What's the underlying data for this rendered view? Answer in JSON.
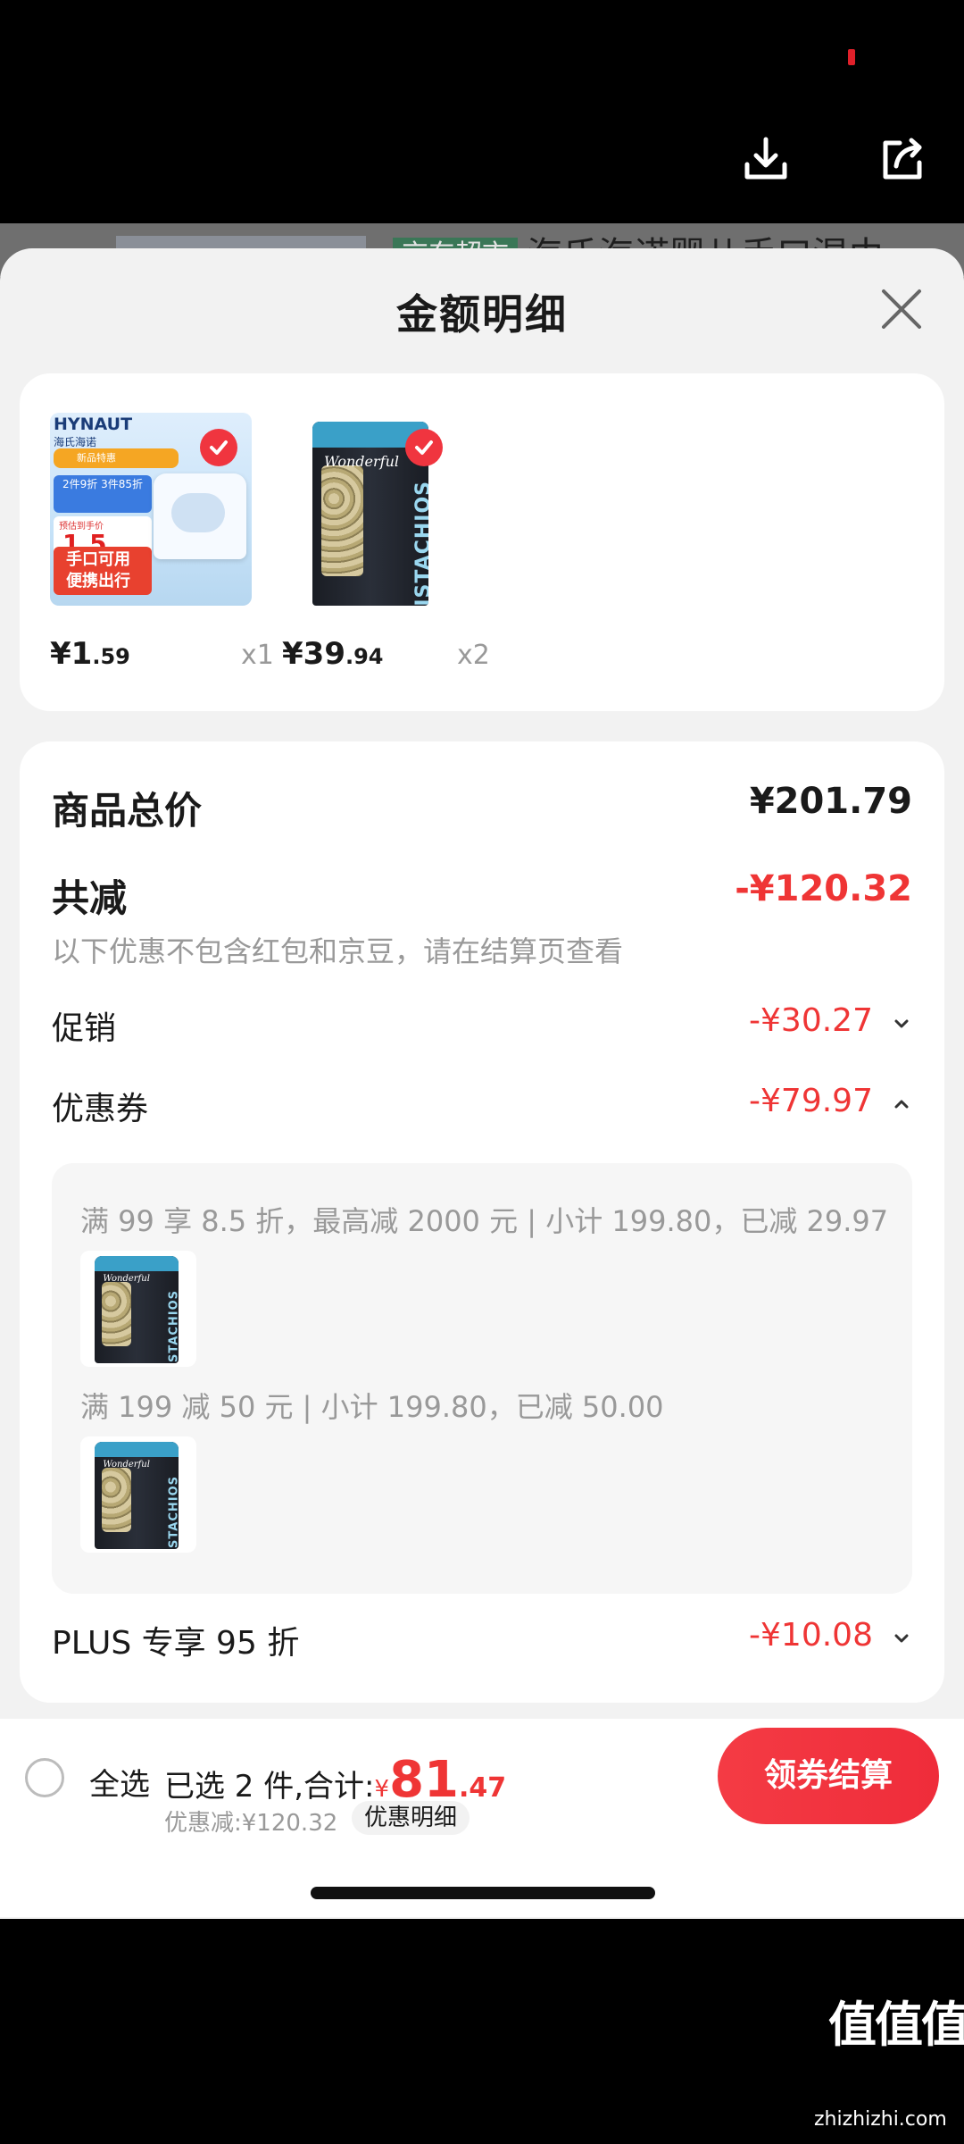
{
  "header": {
    "download_icon": "download-icon",
    "share_icon": "share-icon"
  },
  "background_page": {
    "tag": "京东超市",
    "title": "海氏海诺婴儿手口湿巾"
  },
  "sheet": {
    "title": "金额明细",
    "close_icon": "close-icon"
  },
  "products": [
    {
      "image": {
        "brand": "HYNAUT",
        "brand_sub": "海氏海诺",
        "promo_top": "新品特惠",
        "promo_deal": "2件9折 3件85折",
        "price_label": "预估到手价",
        "price_badge": "1.5",
        "slogan": "手口可用 便携出行"
      },
      "price_int": "¥1",
      "price_dec": ".59",
      "qty": "x1",
      "selected": true
    },
    {
      "image": {
        "brand": "Wonderful",
        "product": "PISTACHIOS"
      },
      "price_int": "¥39",
      "price_dec": ".94",
      "qty": "x2",
      "selected": true
    }
  ],
  "summary": {
    "total_label": "商品总价",
    "total_value": "¥201.79",
    "minus_label": "共减",
    "minus_value": "-¥120.32",
    "note": "以下优惠不包含红包和京豆，请在结算页查看",
    "promo_label": "促销",
    "promo_value": "-¥30.27",
    "coupon_label": "优惠券",
    "coupon_value": "-¥79.97",
    "coupons": [
      {
        "text": "满 99 享 8.5 折，最高减 2000 元 | 小计 199.80，已减 29.97"
      },
      {
        "text": "满 199 减 50 元 | 小计 199.80，已减 50.00"
      }
    ],
    "plus_label": "PLUS 专享 95 折",
    "plus_value": "-¥10.08"
  },
  "bottom": {
    "select_all": "全选",
    "selected_text": "已选 2 件,合计:",
    "currency": "¥",
    "total_int": "81",
    "total_dec": ".47",
    "discount_text": "优惠减:¥120.32",
    "detail_label": "优惠明细",
    "checkout_label": "领券结算"
  },
  "watermark": {
    "cn": "值值值",
    "url": "zhizhizhi.com"
  },
  "colors": {
    "accent_red": "#ef3535",
    "sheet_bg": "#f2f2f2"
  }
}
